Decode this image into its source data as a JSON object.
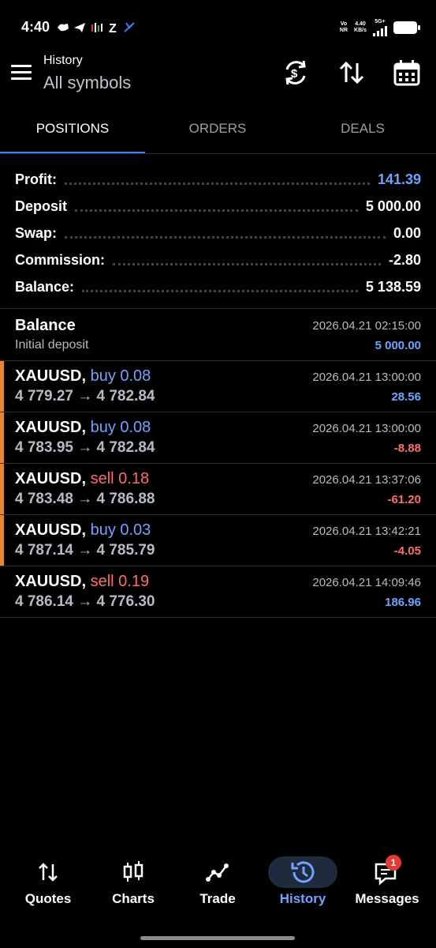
{
  "status_bar": {
    "time": "4:40",
    "icons_text": "Z",
    "net_top": "Vo",
    "net_bottom": "NR",
    "speed_top": "4.40",
    "speed_bottom": "KB/s",
    "network": "5G+"
  },
  "header": {
    "title": "History",
    "subtitle": "All symbols"
  },
  "tabs": [
    {
      "label": "POSITIONS",
      "active": true
    },
    {
      "label": "ORDERS",
      "active": false
    },
    {
      "label": "DEALS",
      "active": false
    }
  ],
  "summary": {
    "profit_label": "Profit:",
    "profit_value": "141.39",
    "deposit_label": "Deposit",
    "deposit_value": "5 000.00",
    "swap_label": "Swap:",
    "swap_value": "0.00",
    "commission_label": "Commission:",
    "commission_value": "-2.80",
    "balance_label": "Balance:",
    "balance_value": "5 138.59"
  },
  "balance_entry": {
    "title": "Balance",
    "subtitle": "Initial deposit",
    "datetime": "2026.04.21 02:15:00",
    "amount": "5 000.00"
  },
  "positions": [
    {
      "symbol": "XAUUSD,",
      "side": "buy 0.08",
      "prices": "4 779.27 → 4 782.84",
      "datetime": "2026.04.21 13:00:00",
      "profit": "28.56"
    },
    {
      "symbol": "XAUUSD,",
      "side": "buy 0.08",
      "prices": "4 783.95 → 4 782.84",
      "datetime": "2026.04.21 13:00:00",
      "profit": "-8.88"
    },
    {
      "symbol": "XAUUSD,",
      "side": "sell 0.18",
      "prices": "4 783.48 → 4 786.88",
      "datetime": "2026.04.21 13:37:06",
      "profit": "-61.20"
    },
    {
      "symbol": "XAUUSD,",
      "side": "buy 0.03",
      "prices": "4 787.14 → 4 785.79",
      "datetime": "2026.04.21 13:42:21",
      "profit": "-4.05"
    },
    {
      "symbol": "XAUUSD,",
      "side": "sell 0.19",
      "prices": "4 786.14 → 4 776.30",
      "datetime": "2026.04.21 14:09:46",
      "profit": "186.96"
    }
  ],
  "bottom_nav": [
    {
      "label": "Quotes",
      "icon": "quotes-arrows-icon"
    },
    {
      "label": "Charts",
      "icon": "candlestick-icon"
    },
    {
      "label": "Trade",
      "icon": "trade-line-icon"
    },
    {
      "label": "History",
      "icon": "history-clock-icon"
    },
    {
      "label": "Messages",
      "icon": "chat-bubble-icon",
      "badge": "1"
    }
  ],
  "colors": {
    "accent_blue": "#6fa3ff",
    "loss_red": "#ff6b6b",
    "indicator_orange": "#e8862f",
    "tab_underline": "#3e82f7"
  }
}
